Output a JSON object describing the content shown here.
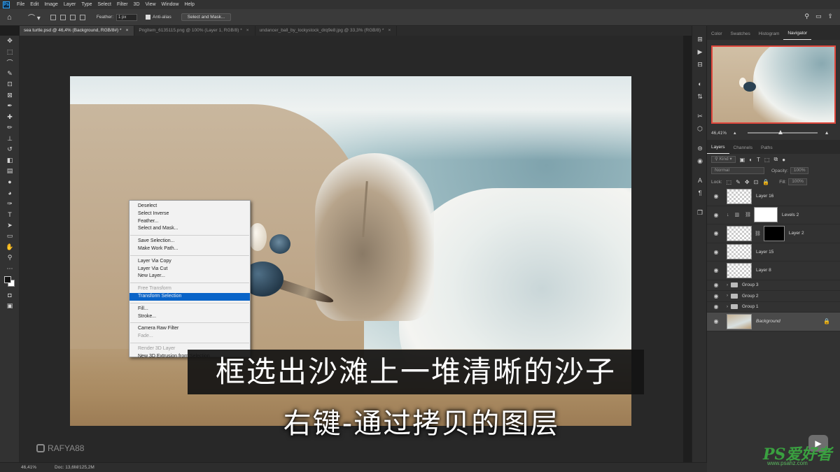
{
  "menubar": {
    "logo": "Ps",
    "items": [
      "File",
      "Edit",
      "Image",
      "Layer",
      "Type",
      "Select",
      "Filter",
      "3D",
      "View",
      "Window",
      "Help"
    ]
  },
  "options": {
    "feather_label": "Feather:",
    "feather_value": "1 px",
    "antialias_label": "Anti-alias",
    "select_mask_button": "Select and Mask..."
  },
  "tabs": [
    {
      "label": "sea turtle.psd @ 46,4% (Background, RGB/8#) *",
      "active": true
    },
    {
      "label": "PngItem_6135115.png @ 100% (Layer 1, RGB/8) *",
      "active": false
    },
    {
      "label": "undancer_ball_by_lockystock_drq9e8.jpg @ 33,3% (RGB/8) *",
      "active": false
    }
  ],
  "context_menu": {
    "items": [
      {
        "label": "Deselect",
        "state": "normal"
      },
      {
        "label": "Select Inverse",
        "state": "normal"
      },
      {
        "label": "Feather...",
        "state": "normal"
      },
      {
        "label": "Select and Mask...",
        "state": "normal"
      },
      {
        "sep": true
      },
      {
        "label": "Save Selection...",
        "state": "normal"
      },
      {
        "label": "Make Work Path...",
        "state": "normal"
      },
      {
        "sep": true
      },
      {
        "label": "Layer Via Copy",
        "state": "normal"
      },
      {
        "label": "Layer Via Cut",
        "state": "normal"
      },
      {
        "label": "New Layer...",
        "state": "normal"
      },
      {
        "sep": true
      },
      {
        "label": "Free Transform",
        "state": "disabled"
      },
      {
        "label": "Transform Selection",
        "state": "selected"
      },
      {
        "sep": true
      },
      {
        "label": "Fill...",
        "state": "normal"
      },
      {
        "label": "Stroke...",
        "state": "normal"
      },
      {
        "sep": true
      },
      {
        "label": "Camera Raw Filter",
        "state": "normal"
      },
      {
        "label": "Fade...",
        "state": "disabled"
      },
      {
        "sep": true
      },
      {
        "label": "Render 3D Layer",
        "state": "disabled"
      },
      {
        "label": "New 3D Extrusion from Selection",
        "state": "normal"
      }
    ]
  },
  "subtitles": {
    "line1": "框选出沙滩上一堆清晰的沙子",
    "line2": "右键-通过拷贝的图层"
  },
  "watermark": "RAFYA88",
  "status": {
    "zoom": "46,41%",
    "doc": "Doc: 13,6M/125,2M"
  },
  "panels": {
    "top_tabs": [
      {
        "label": "Color",
        "active": false
      },
      {
        "label": "Swatches",
        "active": false
      },
      {
        "label": "Histogram",
        "active": false
      },
      {
        "label": "Navigator",
        "active": true
      }
    ],
    "navigator_zoom": "46,41%",
    "layer_tabs": [
      {
        "label": "Layers",
        "active": true
      },
      {
        "label": "Channels",
        "active": false
      },
      {
        "label": "Paths",
        "active": false
      }
    ],
    "kind_label": "Kind",
    "blend_mode": "Normal",
    "opacity_label": "Opacity:",
    "opacity_value": "100%",
    "lock_label": "Lock:",
    "fill_label": "Fill:",
    "fill_value": "100%",
    "layers": [
      {
        "name": "Layer 16",
        "type": "pixel"
      },
      {
        "name": "Levels 2",
        "type": "adjustment"
      },
      {
        "name": "Layer 2",
        "type": "masked"
      },
      {
        "name": "Layer 15",
        "type": "pixel"
      },
      {
        "name": "Layer 8",
        "type": "pixel"
      },
      {
        "name": "Group 3",
        "type": "group"
      },
      {
        "name": "Group 2",
        "type": "group"
      },
      {
        "name": "Group 1",
        "type": "group"
      },
      {
        "name": "Background",
        "type": "background"
      }
    ]
  },
  "site_mark": {
    "logo": "PS爱好者",
    "url": "www.psahz.com"
  },
  "colors": {
    "selection": "#0a64c8",
    "navigator_frame": "#e0473c"
  }
}
